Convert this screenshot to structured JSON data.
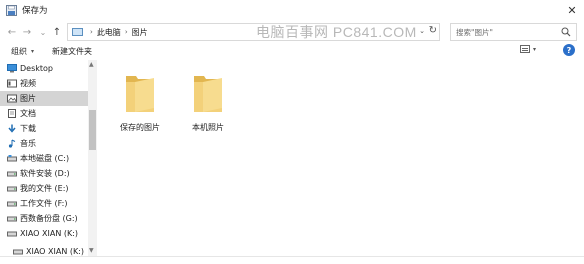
{
  "window": {
    "title": "保存为",
    "close_glyph": "✕"
  },
  "nav": {
    "back_glyph": "←",
    "forward_glyph": "→",
    "recent_glyph": "⌄",
    "up_glyph": "↑"
  },
  "address": {
    "crumbs": [
      "此电脑",
      "图片"
    ],
    "separator": "›",
    "dropdown_glyph": "⌄",
    "refresh_glyph": "↻"
  },
  "watermark": "电脑百事网 PC841.COM",
  "search": {
    "placeholder": "搜索\"图片\""
  },
  "toolbar": {
    "organize_label": "组织",
    "new_folder_label": "新建文件夹",
    "caret": "▾",
    "help_glyph": "?"
  },
  "sidebar": {
    "items": [
      {
        "label": "Desktop",
        "icon": "desktop-icon"
      },
      {
        "label": "视频",
        "icon": "video-icon"
      },
      {
        "label": "图片",
        "icon": "pictures-icon",
        "selected": true
      },
      {
        "label": "文档",
        "icon": "documents-icon"
      },
      {
        "label": "下载",
        "icon": "downloads-icon"
      },
      {
        "label": "音乐",
        "icon": "music-icon"
      },
      {
        "label": "本地磁盘 (C:)",
        "icon": "drive-icon"
      },
      {
        "label": "软件安装 (D:)",
        "icon": "drive-icon"
      },
      {
        "label": "我的文件 (E:)",
        "icon": "drive-icon"
      },
      {
        "label": "工作文件 (F:)",
        "icon": "drive-icon"
      },
      {
        "label": "西数备份盘 (G:)",
        "icon": "drive-icon"
      },
      {
        "label": "XIAO XIAN (K:)",
        "icon": "drive-icon"
      },
      {
        "label": "XIAO XIAN (K:)",
        "icon": "drive-icon"
      }
    ],
    "scroll_up_glyph": "▲",
    "scroll_down_glyph": "▼"
  },
  "folders": [
    {
      "label": "保存的图片",
      "icon": "folder-icon"
    },
    {
      "label": "本机照片",
      "icon": "folder-icon"
    }
  ],
  "colors": {
    "folder": "#f3d17a",
    "folder_dark": "#e2b650",
    "selection": "#d4d4d4",
    "accent": "#2b6fc9"
  }
}
